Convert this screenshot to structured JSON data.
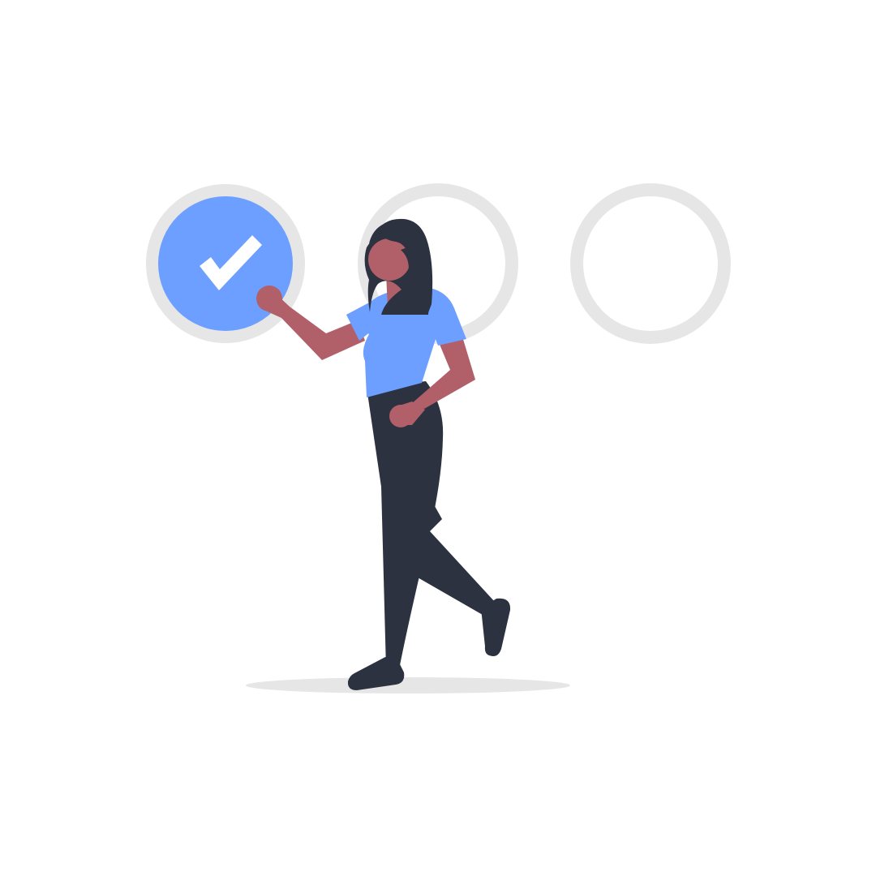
{
  "scene": {
    "description_icons": [
      "checkmark-icon"
    ],
    "steps": [
      {
        "state": "complete",
        "icon": "checkmark-icon"
      },
      {
        "state": "incomplete",
        "icon": ""
      },
      {
        "state": "incomplete",
        "icon": ""
      }
    ]
  },
  "colors": {
    "background": "#ffffff",
    "ring": "#e6e6e6",
    "accent": "#6c9fff",
    "check": "#ffffff",
    "skin": "#b1606a",
    "dark": "#2c3240",
    "shadow": "#e6e6e6"
  }
}
